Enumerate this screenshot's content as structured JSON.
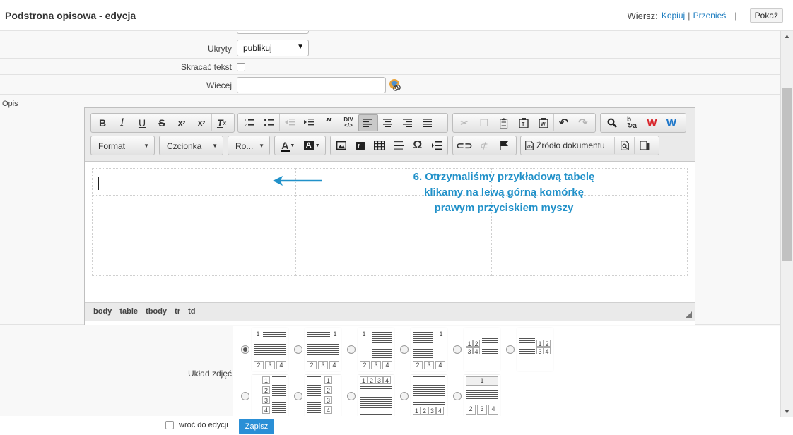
{
  "header": {
    "title": "Podstrona opisowa - edycja",
    "wiersz_label": "Wiersz:",
    "kopiuj": "Kopiuj",
    "sep1": "|",
    "przenies": "Przenieś",
    "sep2": "|",
    "pokaz": "Pokaż"
  },
  "form": {
    "ukryty_label": "Ukryty",
    "ukryty_value": "publikuj",
    "skracac_label": "Skracać tekst",
    "wiecej_label": "Wiecej",
    "wiecej_value": "",
    "opis_label": "Opis"
  },
  "editor": {
    "format": "Format",
    "czcionka": "Czcionka",
    "rozmiar": "Ro...",
    "zrodlo": "Źródło dokumentu",
    "path": [
      "body",
      "table",
      "tbody",
      "tr",
      "td"
    ],
    "annotation": [
      "6. Otrzymaliśmy przykładową tabelę",
      "klikamy na lewą górną komórkę",
      "prawym przyciskiem myszy"
    ]
  },
  "layouts": {
    "label": "Układ zdjęć",
    "selected_index": 0
  },
  "footer": {
    "wroc": "wróć do edycji",
    "zapisz": "Zapisz"
  }
}
